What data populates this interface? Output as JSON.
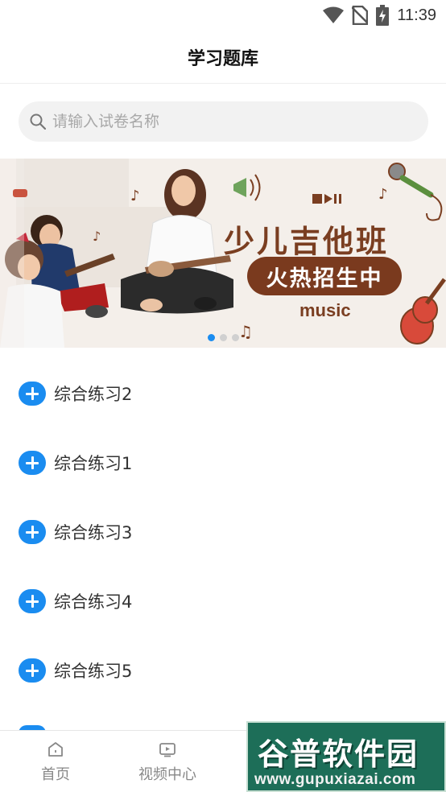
{
  "status_bar": {
    "time": "11:39"
  },
  "header": {
    "title": "学习题库"
  },
  "search": {
    "placeholder": "请输入试卷名称",
    "value": ""
  },
  "banner": {
    "title": "少儿吉他班",
    "subtitle": "火热招生中",
    "tag": "music",
    "slides_total": 3,
    "active_slide": 1
  },
  "practice_items": [
    {
      "label": "综合练习2"
    },
    {
      "label": "综合练习1"
    },
    {
      "label": "综合练习3"
    },
    {
      "label": "综合练习4"
    },
    {
      "label": "综合练习5"
    }
  ],
  "bottom_nav": {
    "home": {
      "label": "首页",
      "icon": "home-icon"
    },
    "video": {
      "label": "视频中心",
      "icon": "video-icon"
    }
  },
  "watermark": {
    "text": "谷普软件园",
    "url": "www.gupuxiazai.com"
  },
  "colors": {
    "accent": "#1a8cf0",
    "banner_brown": "#7a3a1e",
    "watermark_green": "#1d6e58"
  }
}
